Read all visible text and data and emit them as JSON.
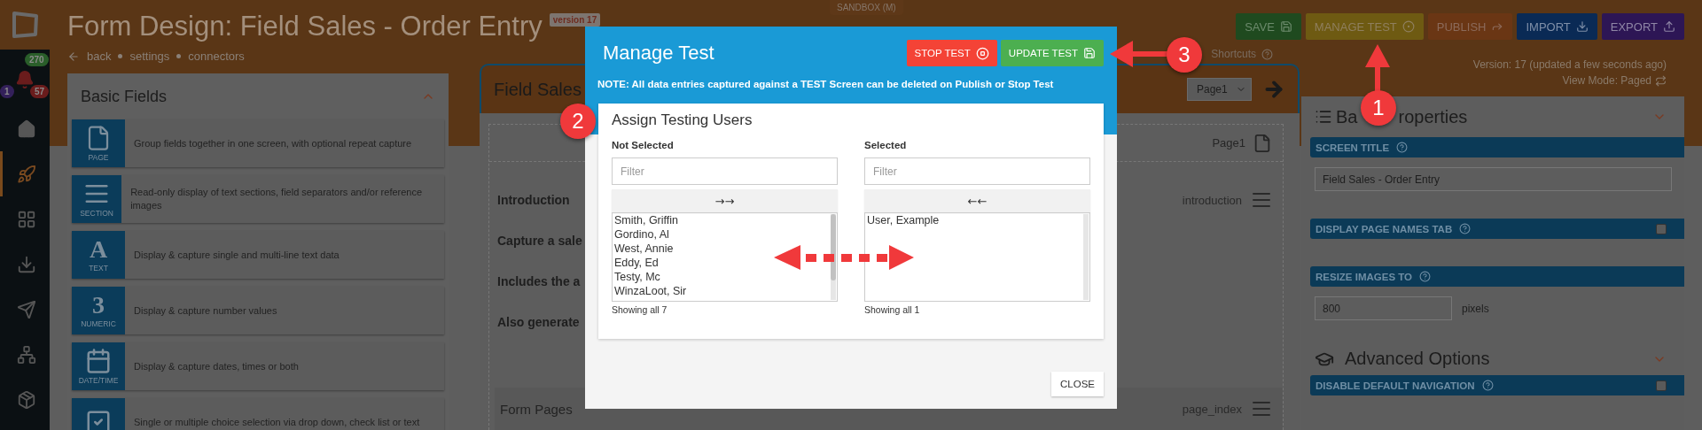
{
  "sidebar": {
    "counters": [
      {
        "label": "270",
        "color": "#2a5e2a"
      },
      {
        "label": "1",
        "color": "#33205a"
      },
      {
        "label": "57",
        "color": "#6a1c1c"
      }
    ],
    "items": [
      {
        "kind": "home",
        "selected": false
      },
      {
        "kind": "rocket",
        "selected": true
      },
      {
        "kind": "grid",
        "selected": false
      },
      {
        "kind": "inbox",
        "selected": false
      },
      {
        "kind": "send",
        "selected": false
      },
      {
        "kind": "sitemap",
        "selected": false
      },
      {
        "kind": "package",
        "selected": false
      }
    ]
  },
  "header": {
    "title": "Form Design: Field Sales - Order Entry",
    "version_badge": "version 17",
    "sandbox": "SANDBOX (M)",
    "breadcrumbs": [
      "back",
      "settings",
      "connectors"
    ],
    "buttons": [
      {
        "label": "SAVE",
        "kind": "save"
      },
      {
        "label": "MANAGE TEST",
        "kind": "manage"
      },
      {
        "label": "PUBLISH",
        "kind": "publish"
      },
      {
        "label": "IMPORT",
        "kind": "import"
      },
      {
        "label": "EXPORT",
        "kind": "export"
      }
    ],
    "version": "Version: 17 (updated a few seconds ago)",
    "view_mode": "View Mode: Paged"
  },
  "basic_fields": {
    "title": "Basic Fields",
    "expanded": true,
    "items": [
      {
        "kind": "page",
        "tile_label": "PAGE",
        "description": "Group fields together in one screen, with optional repeat capture"
      },
      {
        "kind": "section",
        "tile_label": "SECTION",
        "description": "Read-only display of text sections, field separators and/or reference images"
      },
      {
        "kind": "glyph",
        "glyph": "A",
        "tile_label": "TEXT",
        "description": "Display & capture single and multi-line text data"
      },
      {
        "kind": "glyph",
        "glyph": "3",
        "tile_label": "NUMERIC",
        "description": "Display & capture number values"
      },
      {
        "kind": "date",
        "tile_label": "DATE/TIME",
        "description": "Display & capture dates, times or both"
      },
      {
        "kind": "choice",
        "description": "Single or multiple choice selection via drop down, check list or text"
      }
    ]
  },
  "canvas": {
    "shortcuts": "Shortcuts",
    "card_title": "Field Sales",
    "page_select": "Page1",
    "page_label": "Page1",
    "rows": [
      {
        "text": "Introduction",
        "name": "introduction"
      },
      {
        "text": "Capture a sale"
      },
      {
        "text": "Includes the a"
      },
      {
        "text": "Also generate"
      }
    ],
    "form_pages": {
      "title": "Form Pages",
      "name": "page_index"
    }
  },
  "properties": {
    "title_parts": [
      "Ba",
      "roperties"
    ],
    "expanded": false,
    "fields": [
      {
        "kind": "text",
        "label": "SCREEN TITLE",
        "value": "Field Sales - Order Entry"
      },
      {
        "kind": "checkbox",
        "label": "DISPLAY PAGE NAMES TAB",
        "checked": false
      },
      {
        "kind": "number",
        "label": "RESIZE IMAGES TO",
        "value": "800",
        "unit": "pixels"
      }
    ],
    "advanced": {
      "title": "Advanced Options",
      "expanded": false,
      "fields": [
        {
          "kind": "checkbox",
          "label": "DISABLE DEFAULT NAVIGATION",
          "checked": false
        }
      ]
    }
  },
  "modal": {
    "title": "Manage Test",
    "stop_button": "STOP TEST",
    "update_button": "UPDATE TEST",
    "note": "NOTE: All data entries captured against a TEST Screen can be deleted on Publish or Stop Test",
    "section_title": "Assign Testing Users",
    "columns": [
      {
        "heading": "Not Selected",
        "placeholder": "Filter",
        "move": "→→",
        "items": [
          "Smith, Griffin",
          "Gordino, Al",
          "West, Annie",
          "Eddy, Ed",
          "Testy, Mc",
          "WinzaLoot, Sir"
        ],
        "footer": "Showing all 7"
      },
      {
        "heading": "Selected",
        "placeholder": "Filter",
        "move": "←←",
        "items": [
          "User, Example"
        ],
        "footer": "Showing all 1"
      }
    ],
    "close": "CLOSE"
  },
  "annotations": [
    {
      "label": "1"
    },
    {
      "label": "2"
    },
    {
      "label": "3"
    }
  ]
}
